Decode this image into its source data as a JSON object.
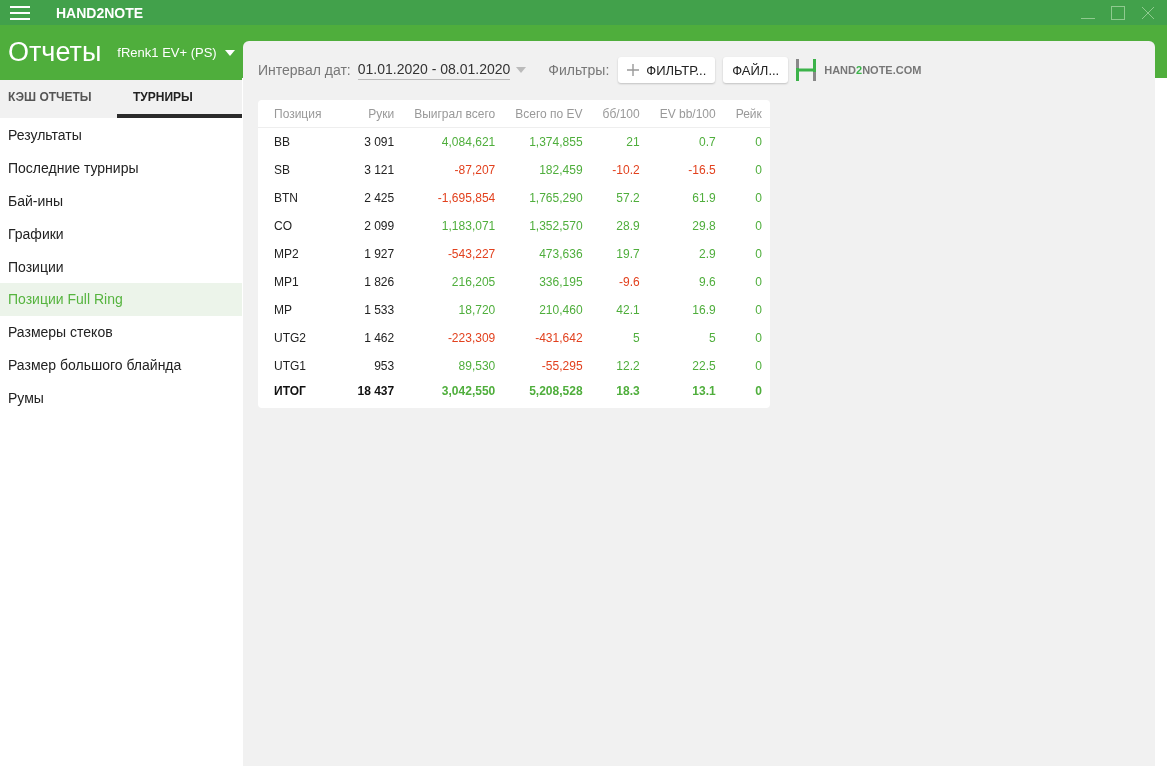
{
  "window": {
    "title": "HAND2NOTE"
  },
  "header": {
    "title": "Отчеты",
    "player": "fRenk1 EV+ (PS)"
  },
  "tabs": [
    {
      "label": "КЭШ ОТЧЕТЫ",
      "selected": false
    },
    {
      "label": "ТУРНИРЫ",
      "selected": true
    }
  ],
  "sidebar": {
    "items": [
      {
        "label": "Результаты",
        "selected": false
      },
      {
        "label": "Последние турниры",
        "selected": false
      },
      {
        "label": "Бай-ины",
        "selected": false
      },
      {
        "label": "Графики",
        "selected": false
      },
      {
        "label": "Позиции",
        "selected": false
      },
      {
        "label": "Позиции Full Ring",
        "selected": true
      },
      {
        "label": "Размеры стеков",
        "selected": false
      },
      {
        "label": "Размер большого блайнда",
        "selected": false
      },
      {
        "label": "Румы",
        "selected": false
      }
    ]
  },
  "toolbar": {
    "date_label": "Интервал дат:",
    "date_range": "01.01.2020 - 08.01.2020",
    "filters_label": "Фильтры:",
    "filter_button": "ФИЛЬТР...",
    "file_button": "ФАЙЛ...",
    "logo": [
      {
        "text": "HAND",
        "accent": false
      },
      {
        "text": "2",
        "accent": true
      },
      {
        "text": "NOTE.COM",
        "accent": false
      }
    ]
  },
  "table": {
    "columns": [
      "Позиция",
      "Руки",
      "Выиграл всего",
      "Всего по EV",
      "бб/100",
      "EV bb/100",
      "Рейк"
    ],
    "rows": [
      {
        "total": false,
        "position": "BB",
        "hands": "3 091",
        "values": [
          {
            "text": "4,084,621",
            "negative": false
          },
          {
            "text": "1,374,855",
            "negative": false
          },
          {
            "text": "21",
            "negative": false
          },
          {
            "text": "0.7",
            "negative": false
          },
          {
            "text": "0",
            "negative": false
          }
        ]
      },
      {
        "total": false,
        "position": "SB",
        "hands": "3 121",
        "values": [
          {
            "text": "-87,207",
            "negative": true
          },
          {
            "text": "182,459",
            "negative": false
          },
          {
            "text": "-10.2",
            "negative": true
          },
          {
            "text": "-16.5",
            "negative": true
          },
          {
            "text": "0",
            "negative": false
          }
        ]
      },
      {
        "total": false,
        "position": "BTN",
        "hands": "2 425",
        "values": [
          {
            "text": "-1,695,854",
            "negative": true
          },
          {
            "text": "1,765,290",
            "negative": false
          },
          {
            "text": "57.2",
            "negative": false
          },
          {
            "text": "61.9",
            "negative": false
          },
          {
            "text": "0",
            "negative": false
          }
        ]
      },
      {
        "total": false,
        "position": "CO",
        "hands": "2 099",
        "values": [
          {
            "text": "1,183,071",
            "negative": false
          },
          {
            "text": "1,352,570",
            "negative": false
          },
          {
            "text": "28.9",
            "negative": false
          },
          {
            "text": "29.8",
            "negative": false
          },
          {
            "text": "0",
            "negative": false
          }
        ]
      },
      {
        "total": false,
        "position": "MP2",
        "hands": "1 927",
        "values": [
          {
            "text": "-543,227",
            "negative": true
          },
          {
            "text": "473,636",
            "negative": false
          },
          {
            "text": "19.7",
            "negative": false
          },
          {
            "text": "2.9",
            "negative": false
          },
          {
            "text": "0",
            "negative": false
          }
        ]
      },
      {
        "total": false,
        "position": "MP1",
        "hands": "1 826",
        "values": [
          {
            "text": "216,205",
            "negative": false
          },
          {
            "text": "336,195",
            "negative": false
          },
          {
            "text": "-9.6",
            "negative": true
          },
          {
            "text": "9.6",
            "negative": false
          },
          {
            "text": "0",
            "negative": false
          }
        ]
      },
      {
        "total": false,
        "position": "MP",
        "hands": "1 533",
        "values": [
          {
            "text": "18,720",
            "negative": false
          },
          {
            "text": "210,460",
            "negative": false
          },
          {
            "text": "42.1",
            "negative": false
          },
          {
            "text": "16.9",
            "negative": false
          },
          {
            "text": "0",
            "negative": false
          }
        ]
      },
      {
        "total": false,
        "position": "UTG2",
        "hands": "1 462",
        "values": [
          {
            "text": "-223,309",
            "negative": true
          },
          {
            "text": "-431,642",
            "negative": true
          },
          {
            "text": "5",
            "negative": false
          },
          {
            "text": "5",
            "negative": false
          },
          {
            "text": "0",
            "negative": false
          }
        ]
      },
      {
        "total": false,
        "position": "UTG1",
        "hands": "953",
        "values": [
          {
            "text": "89,530",
            "negative": false
          },
          {
            "text": "-55,295",
            "negative": true
          },
          {
            "text": "12.2",
            "negative": false
          },
          {
            "text": "22.5",
            "negative": false
          },
          {
            "text": "0",
            "negative": false
          }
        ]
      },
      {
        "total": true,
        "position": "ИТОГ",
        "hands": "18 437",
        "values": [
          {
            "text": "3,042,550",
            "negative": false
          },
          {
            "text": "5,208,528",
            "negative": false
          },
          {
            "text": "18.3",
            "negative": false
          },
          {
            "text": "13.1",
            "negative": false
          },
          {
            "text": "0",
            "negative": false
          }
        ]
      }
    ]
  }
}
